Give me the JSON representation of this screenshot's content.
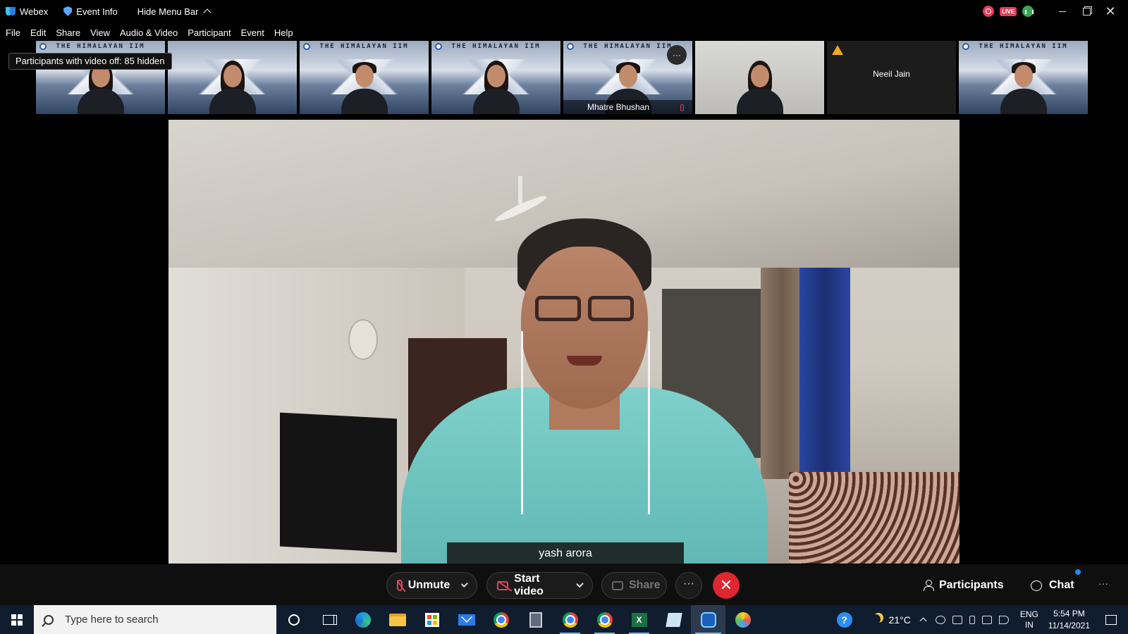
{
  "titlebar": {
    "app_name": "Webex",
    "event_info": "Event Info",
    "hide_menu": "Hide Menu Bar",
    "live": "LIVE"
  },
  "menu": [
    "File",
    "Edit",
    "Share",
    "View",
    "Audio & Video",
    "Participant",
    "Event",
    "Help"
  ],
  "tooltip": "Participants with video off: 85 hidden",
  "thumbnails": [
    {
      "banner": "THE HIMALAYAN IIM",
      "name": ""
    },
    {
      "banner": "",
      "name": ""
    },
    {
      "banner": "THE HIMALAYAN IIM",
      "name": ""
    },
    {
      "banner": "THE HIMALAYAN IIM",
      "name": ""
    },
    {
      "banner": "THE HIMALAYAN IIM",
      "name": "Mhatre Bhushan",
      "more": "···"
    },
    {
      "banner": "",
      "name": ""
    },
    {
      "banner": "",
      "name": "Neeil Jain"
    },
    {
      "banner": "THE HIMALAYAN IIM",
      "name": ""
    }
  ],
  "main_video": {
    "speaker_name": "yash arora"
  },
  "controls": {
    "unmute": "Unmute",
    "start_video": "Start video",
    "share": "Share",
    "more": "···",
    "leave": "✕",
    "participants": "Participants",
    "chat": "Chat",
    "overflow": "···"
  },
  "taskbar": {
    "search_placeholder": "Type here to search",
    "temperature": "21°C",
    "lang_1": "ENG",
    "lang_2": "IN",
    "time": "5:54 PM",
    "date": "11/14/2021",
    "excel_letter": "X",
    "help": "?"
  },
  "colors": {
    "leave_red": "#e0262f",
    "muted_red": "#e2405a",
    "taskbar_bg": "#101d2e"
  }
}
